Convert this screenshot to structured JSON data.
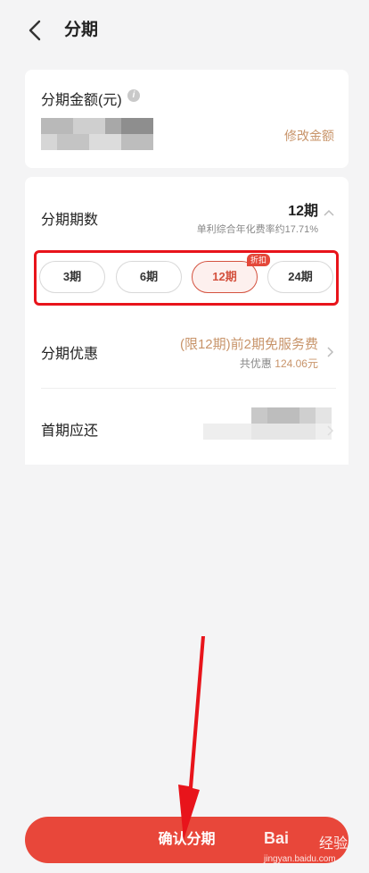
{
  "header": {
    "title": "分期"
  },
  "amount_card": {
    "label": "分期金额(元)",
    "info_glyph": "i",
    "modify_label": "修改金额"
  },
  "plan_card": {
    "terms_label": "分期期数",
    "selected_term": "12期",
    "rate_text": "单利综合年化费率约17.71%",
    "options": [
      {
        "label": "3期",
        "selected": false
      },
      {
        "label": "6期",
        "selected": false
      },
      {
        "label": "12期",
        "selected": true
      },
      {
        "label": "24期",
        "selected": false
      }
    ],
    "discount_badge": "折扣",
    "promo_label": "分期优惠",
    "promo_title": "(限12期)前2期免服务费",
    "promo_sub_prefix": "共优惠",
    "promo_sub_amount": "124.06元",
    "first_payment_label": "首期应还"
  },
  "confirm_label": "确认分期",
  "watermark": {
    "brand": "Bai",
    "cn": "经验",
    "url": "jingyan.baidu.com"
  },
  "colors": {
    "accent": "#e8473a",
    "gold": "#c8946a",
    "highlight": "#e8141b"
  },
  "icons": [
    "back-arrow-icon",
    "info-icon",
    "chevron-up-icon",
    "chevron-right-icon"
  ]
}
